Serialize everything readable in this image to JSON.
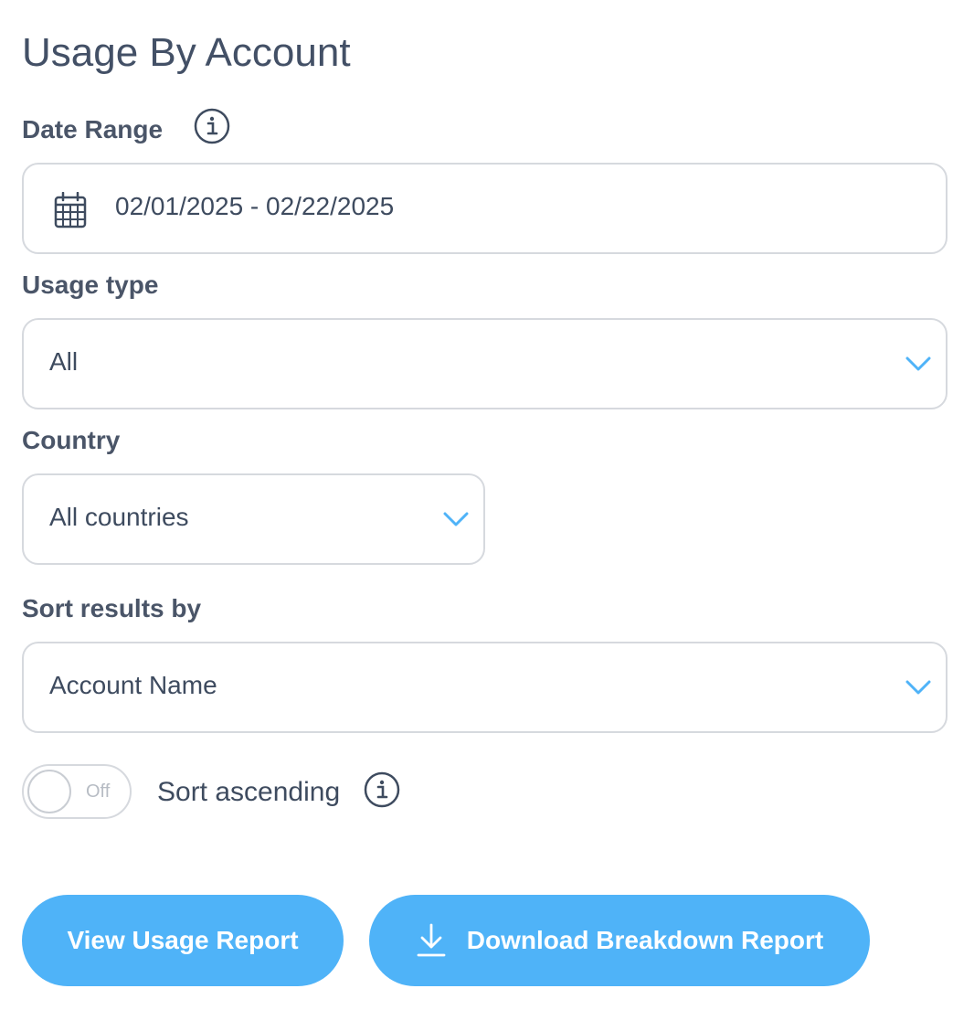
{
  "page": {
    "title": "Usage By Account"
  },
  "date_range": {
    "label": "Date Range",
    "info_icon": "info-icon",
    "calendar_icon": "calendar-icon",
    "value": "02/01/2025 - 02/22/2025"
  },
  "usage_type": {
    "label": "Usage type",
    "selected": "All",
    "icon": "chevron-down-icon"
  },
  "country": {
    "label": "Country",
    "selected": "All countries",
    "icon": "chevron-down-icon"
  },
  "sort_by": {
    "label": "Sort results by",
    "selected": "Account Name",
    "icon": "chevron-down-icon"
  },
  "sort_ascending": {
    "toggle_state": "Off",
    "label": "Sort ascending",
    "info_icon": "info-icon"
  },
  "buttons": {
    "view_label": "View Usage Report",
    "download_label": "Download Breakdown Report",
    "download_icon": "download-icon"
  },
  "colors": {
    "accent": "#4fb3f8",
    "chevron": "#4fb3f8",
    "text": "#3e4b5f",
    "border": "#d6d9de"
  }
}
